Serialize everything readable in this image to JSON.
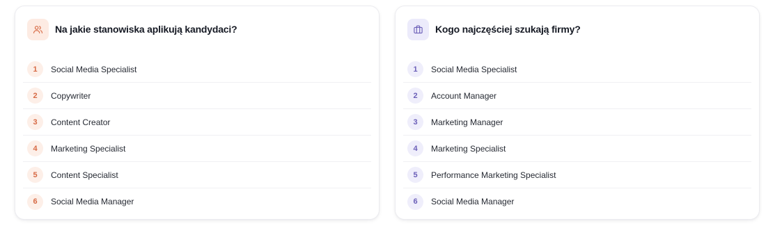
{
  "cards": [
    {
      "title": "Na jakie stanowiska aplikują kandydaci?",
      "icon": "users-icon",
      "accent": "#d76a45",
      "items": [
        {
          "rank": "1",
          "label": "Social Media Specialist"
        },
        {
          "rank": "2",
          "label": "Copywriter"
        },
        {
          "rank": "3",
          "label": "Content Creator"
        },
        {
          "rank": "4",
          "label": "Marketing Specialist"
        },
        {
          "rank": "5",
          "label": "Content Specialist"
        },
        {
          "rank": "6",
          "label": "Social Media Manager"
        }
      ]
    },
    {
      "title": "Kogo najczęściej szukają firmy?",
      "icon": "briefcase-icon",
      "accent": "#6b5fb8",
      "items": [
        {
          "rank": "1",
          "label": "Social Media Specialist"
        },
        {
          "rank": "2",
          "label": "Account Manager"
        },
        {
          "rank": "3",
          "label": "Marketing Manager"
        },
        {
          "rank": "4",
          "label": "Marketing Specialist"
        },
        {
          "rank": "5",
          "label": "Performance Marketing Specialist"
        },
        {
          "rank": "6",
          "label": "Social Media Manager"
        }
      ]
    }
  ]
}
